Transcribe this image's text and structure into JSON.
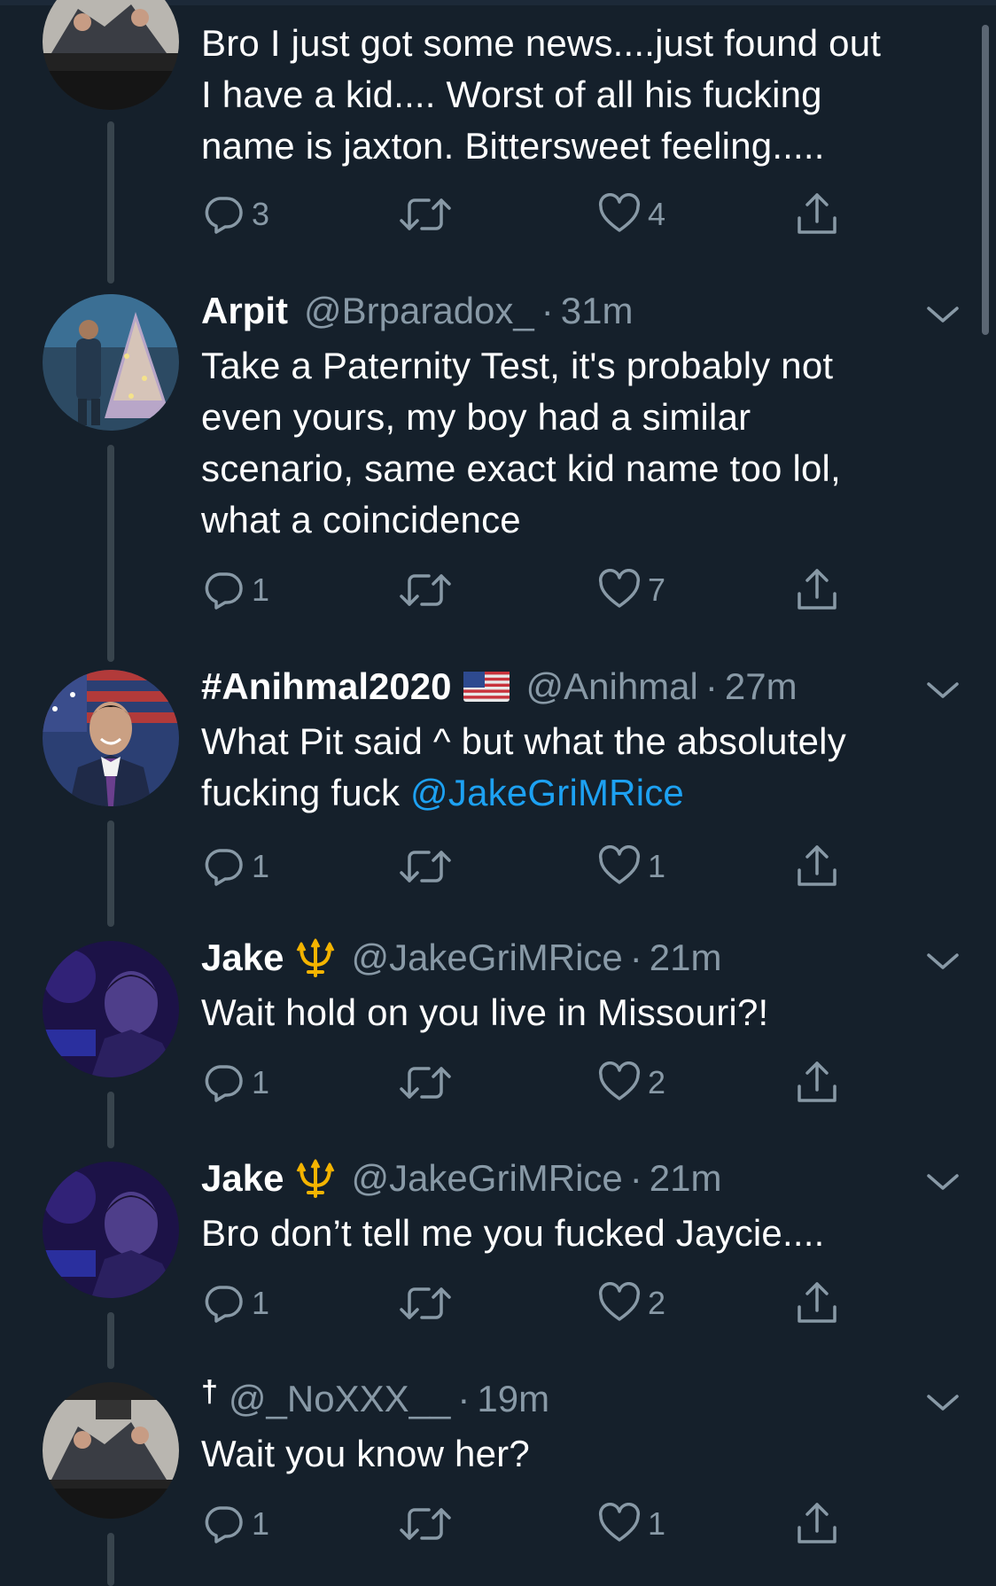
{
  "tweets": [
    {
      "name": "",
      "handle": "",
      "time": "",
      "text_lines": [
        "Bro I just got some news....just found out",
        "I have a kid.... Worst of all his fucking",
        "name is jaxton. Bittersweet feeling....."
      ],
      "replies": "3",
      "likes": "4"
    },
    {
      "name": "Arpit",
      "handle": "@Brparadox_",
      "separator": "·",
      "time": "31m",
      "text_lines": [
        "Take a Paternity Test, it's probably not",
        "even yours, my boy had a similar",
        "scenario, same exact kid name too lol,",
        "what a coincidence"
      ],
      "replies": "1",
      "likes": "7"
    },
    {
      "name": "#Anihmal2020",
      "emoji": "us-flag",
      "handle": "@Anihmal",
      "separator": "·",
      "time": "27m",
      "text_line1": "What Pit said ^ but what the absolutely",
      "text_line2_prefix": "fucking fuck ",
      "mention": "@JakeGriMRice",
      "replies": "1",
      "likes": "1"
    },
    {
      "name": "Jake",
      "emoji": "trident",
      "handle": "@JakeGriMRice",
      "separator": "·",
      "time": "21m",
      "text_lines": [
        "Wait hold on you live in Missouri?!"
      ],
      "replies": "1",
      "likes": "2"
    },
    {
      "name": "Jake",
      "emoji": "trident",
      "handle": "@JakeGriMRice",
      "separator": "·",
      "time": "21m",
      "text_lines": [
        "Bro don’t tell me you fucked Jaycie...."
      ],
      "replies": "1",
      "likes": "2"
    },
    {
      "prefix": "†",
      "handle": "@_NoXXX__",
      "separator": "·",
      "time": "19m",
      "text_lines": [
        "Wait you know her?"
      ],
      "replies": "1",
      "likes": "1"
    }
  ],
  "icons": {
    "reply": "reply-icon",
    "retweet": "retweet-icon",
    "like": "like-icon",
    "share": "share-icon",
    "menu": "chevron-down-icon"
  },
  "colors": {
    "background": "#15202b",
    "secondary_text": "#8899a6",
    "mention": "#1da1f2",
    "thread_line": "#38444d"
  }
}
